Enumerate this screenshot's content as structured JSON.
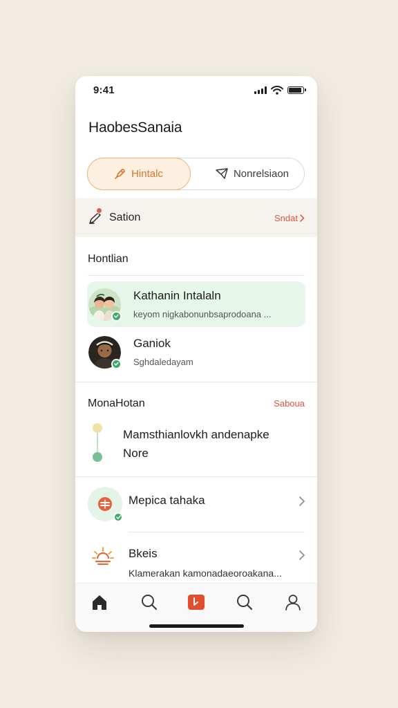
{
  "status": {
    "time": "9:41"
  },
  "app": {
    "title": "HaobesSanaia"
  },
  "segments": [
    {
      "label": "Hintalc",
      "active": true,
      "icon": "rocket-icon"
    },
    {
      "label": "Nonrelsiaon",
      "active": false,
      "icon": "paper-plane-icon"
    }
  ],
  "section_bar": {
    "title": "Sation",
    "link": "Sndat",
    "icon": "pen-icon"
  },
  "contacts_section": {
    "heading": "Hontlian",
    "items": [
      {
        "name": "Kathanin Intalaln",
        "subtitle": "keyom nigkabonunbsaprodoana ...",
        "highlighted": true
      },
      {
        "name": "Ganiok",
        "subtitle": "Sghdaledayam",
        "highlighted": false
      }
    ]
  },
  "moments_section": {
    "heading": "MonaHotan",
    "link": "Saboua",
    "timeline_text": "Mamsthianlovkh andenapke Nore"
  },
  "list": [
    {
      "title": "Mepica tahaka",
      "subtitle": "",
      "icon": "badge-icon"
    },
    {
      "title": "Bkeis",
      "subtitle": "Klamerakan kamonadaeoroakana...",
      "icon": "sun-icon"
    }
  ],
  "nav": [
    {
      "name": "home",
      "icon": "home-icon",
      "active": true
    },
    {
      "name": "search",
      "icon": "search-icon",
      "active": false
    },
    {
      "name": "compose",
      "icon": "flag-icon",
      "active": false
    },
    {
      "name": "explore",
      "icon": "search-icon",
      "active": false
    },
    {
      "name": "profile",
      "icon": "person-icon",
      "active": false
    }
  ],
  "colors": {
    "accent": "#d9573f",
    "segment_active": "#d6752b",
    "highlight_bg": "#e6f6e9",
    "online": "#3fa96a",
    "background": "#f1ede4"
  }
}
